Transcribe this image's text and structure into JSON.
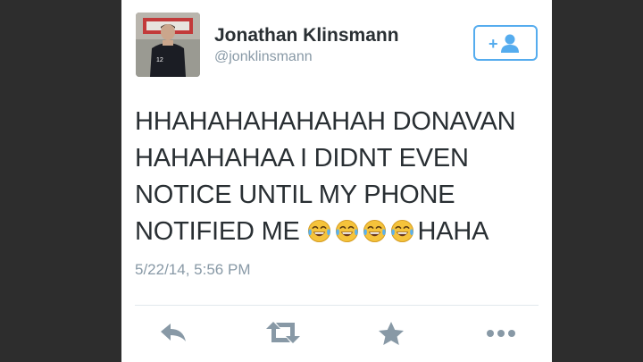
{
  "user": {
    "display_name": "Jonathan Klinsmann",
    "screen_name": "@jonklinsmann",
    "jersey_number": "12"
  },
  "follow_button": {
    "label": "+"
  },
  "tweet": {
    "lines": [
      "HHAHAHAHAHAHAH DONAVAN",
      "HAHAHAHAA I DIDNT EVEN",
      "NOTICE UNTIL MY PHONE",
      "NOTIFIED ME"
    ],
    "trailing_text": "HAHA",
    "emoji_name": "face-with-tears-of-joy",
    "emoji_count": 4,
    "timestamp": "5/22/14, 5:56 PM"
  },
  "actions": [
    {
      "name": "reply",
      "icon": "reply-icon"
    },
    {
      "name": "retweet",
      "icon": "retweet-icon"
    },
    {
      "name": "favorite",
      "icon": "star-icon"
    },
    {
      "name": "more",
      "icon": "more-icon"
    }
  ],
  "colors": {
    "name_text": "#292f33",
    "meta_text": "#8899a6",
    "accent": "#55acee",
    "action_icons": "#8899a6",
    "emoji_face": "#f5c33b"
  }
}
